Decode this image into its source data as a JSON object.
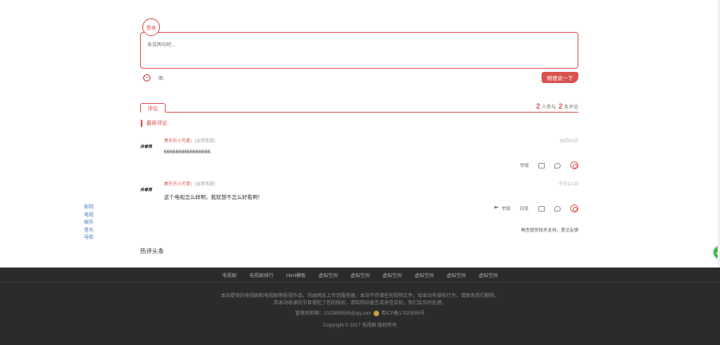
{
  "comment_form": {
    "login_label": "登录",
    "placeholder": "来说两句吧...",
    "image_label": "图",
    "submit_label": "随便说一下"
  },
  "comments_header": {
    "tab_label": "评论",
    "participants_count": "2",
    "participants_label": "人参与,",
    "comments_count": "2",
    "comments_label": "条评论"
  },
  "latest_title": "最新评论",
  "comments": [
    {
      "avatar_text": "尚睿雅",
      "user": "美乐乐小可爱♪",
      "meta": "[金牌客服]",
      "time": "09月01日",
      "body": "6666666666666666",
      "actions": {
        "report": "举报"
      }
    },
    {
      "avatar_text": "尚睿雅",
      "user": "美乐乐小可爱♪",
      "meta": "[金牌客服]",
      "time": "今天12:23",
      "body": "这个电视怎么样啊，我就想不怎么好看啊！",
      "actions": {
        "flag": "举报",
        "report": "回复"
      }
    }
  ],
  "powered_by": "畅言提供技术支持，意见反馈",
  "side_nav": [
    "影院",
    "电视",
    "娱乐",
    "音乐",
    "导航"
  ],
  "hot_comments_title": "热评头条",
  "footer": {
    "nav": [
      "电视剧",
      "电视剧排行",
      "Html模板",
      "虚拟空间",
      "虚拟空间",
      "虚拟空间",
      "虚拟空间",
      "虚拟空间",
      "虚拟空间"
    ],
    "disclaimer_1": "本站提供的电视剧和电视剧等影视作品，均由网友上传到服务器，本站不存储任何视频文件。如本站有侵权行为，请联系我们删除。",
    "disclaimer_2": "若本站收录的节目侵犯了您的版权，请给网站留言或来信告知，我们会及时处理。",
    "contact": "管理员邮箱：2323890595@qq.com",
    "icp": "粤ICP备17023095号",
    "copyright": "Copyright © 2017  电视剧  版权所有"
  },
  "colors": {
    "accent": "#d9534f",
    "footer_bg": "#2b2b2b",
    "link": "#4a7ab8"
  }
}
